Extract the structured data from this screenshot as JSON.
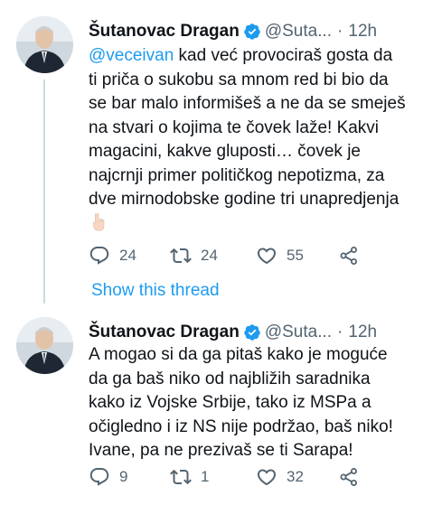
{
  "tweets": [
    {
      "name": "Šutanovac Dragan",
      "handle": "@Suta...",
      "dot": "·",
      "time": "12h",
      "mention": "@veceivan",
      "lines": [
        " kad već provociraš gosta da",
        "ti priča o sukobu sa mnom red bi bio da",
        "se bar malo informišeš a ne da se smeješ",
        "na stvari o kojima te čovek laže!  Kakvi",
        "magacini, kakve gluposti… čovek je",
        "najcrnji primer političkog nepotizma, za",
        "dve mirnodobske godine tri unapredjenja"
      ],
      "emoji": "👇🏻",
      "replies": "24",
      "retweets": "24",
      "likes": "55"
    },
    {
      "name": "Šutanovac Dragan",
      "handle": "@Suta...",
      "dot": "·",
      "time": "12h",
      "lines": [
        "A mogao si da ga pitaš kako je moguće",
        "da ga baš niko od najbližih saradnika",
        "kako iz Vojske Srbije, tako iz MSPa a",
        "očigledno i iz NS nije podržao, baš niko!",
        "Ivane, pa ne prezivaš se ti Sarapa!"
      ],
      "replies": "9",
      "retweets": "1",
      "likes": "32"
    }
  ],
  "show_thread": "Show this thread",
  "colors": {
    "accent": "#1d9bf0",
    "muted": "#536471",
    "text": "#0f1419"
  },
  "icons": [
    "verified-badge-icon",
    "reply-icon",
    "retweet-icon",
    "like-icon",
    "share-icon"
  ]
}
